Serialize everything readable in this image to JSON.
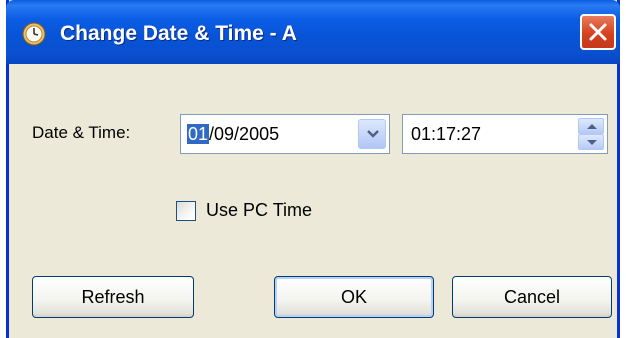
{
  "window": {
    "title": "Change Date & Time - A"
  },
  "form": {
    "date_time_label": "Date & Time:",
    "date": {
      "selected_segment": "01",
      "rest": "/09/2005"
    },
    "time": "01:17:27",
    "use_pc_time_label": "Use PC Time",
    "use_pc_time_checked": false
  },
  "buttons": {
    "refresh": "Refresh",
    "ok": "OK",
    "cancel": "Cancel"
  },
  "colors": {
    "titlebar": "#0853d6",
    "dialog_bg": "#ece9d8",
    "selection": "#316ac5",
    "close": "#d4421f"
  }
}
